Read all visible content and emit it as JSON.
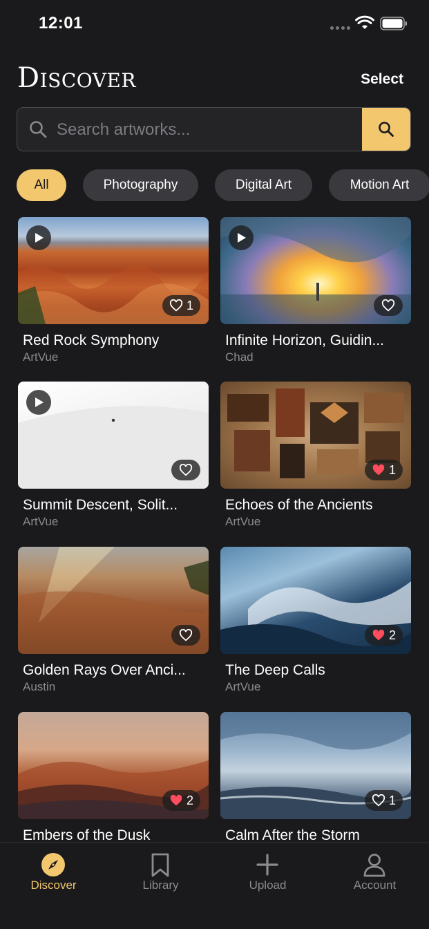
{
  "status_bar": {
    "time": "12:01"
  },
  "header": {
    "title": "Discover",
    "select_label": "Select"
  },
  "search": {
    "placeholder": "Search artworks...",
    "value": ""
  },
  "filters": [
    {
      "label": "All",
      "active": true
    },
    {
      "label": "Photography",
      "active": false
    },
    {
      "label": "Digital Art",
      "active": false
    },
    {
      "label": "Motion Art",
      "active": false
    }
  ],
  "artworks": [
    {
      "title": "Red Rock Symphony",
      "author": "ArtVue",
      "video": true,
      "likes": "1",
      "liked": false
    },
    {
      "title": "Infinite Horizon, Guidin...",
      "author": "Chad",
      "video": true,
      "likes": "",
      "liked": false
    },
    {
      "title": "Summit Descent, Solit...",
      "author": "ArtVue",
      "video": true,
      "likes": "",
      "liked": false
    },
    {
      "title": "Echoes of the Ancients",
      "author": "ArtVue",
      "video": false,
      "likes": "1",
      "liked": true
    },
    {
      "title": "Golden Rays Over Anci...",
      "author": "Austin",
      "video": false,
      "likes": "",
      "liked": false
    },
    {
      "title": "The Deep Calls",
      "author": "ArtVue",
      "video": false,
      "likes": "2",
      "liked": true
    },
    {
      "title": "Embers of the Dusk",
      "author": "",
      "video": false,
      "likes": "2",
      "liked": true
    },
    {
      "title": "Calm After the Storm",
      "author": "",
      "video": false,
      "likes": "1",
      "liked": false
    }
  ],
  "tab_bar": [
    {
      "label": "Discover",
      "icon": "compass-icon",
      "active": true
    },
    {
      "label": "Library",
      "icon": "bookmark-icon",
      "active": false
    },
    {
      "label": "Upload",
      "icon": "plus-icon",
      "active": false
    },
    {
      "label": "Account",
      "icon": "person-icon",
      "active": false
    }
  ],
  "colors": {
    "accent": "#f2c76e",
    "background": "#1a1a1c",
    "heart_liked": "#ff4d5e"
  }
}
